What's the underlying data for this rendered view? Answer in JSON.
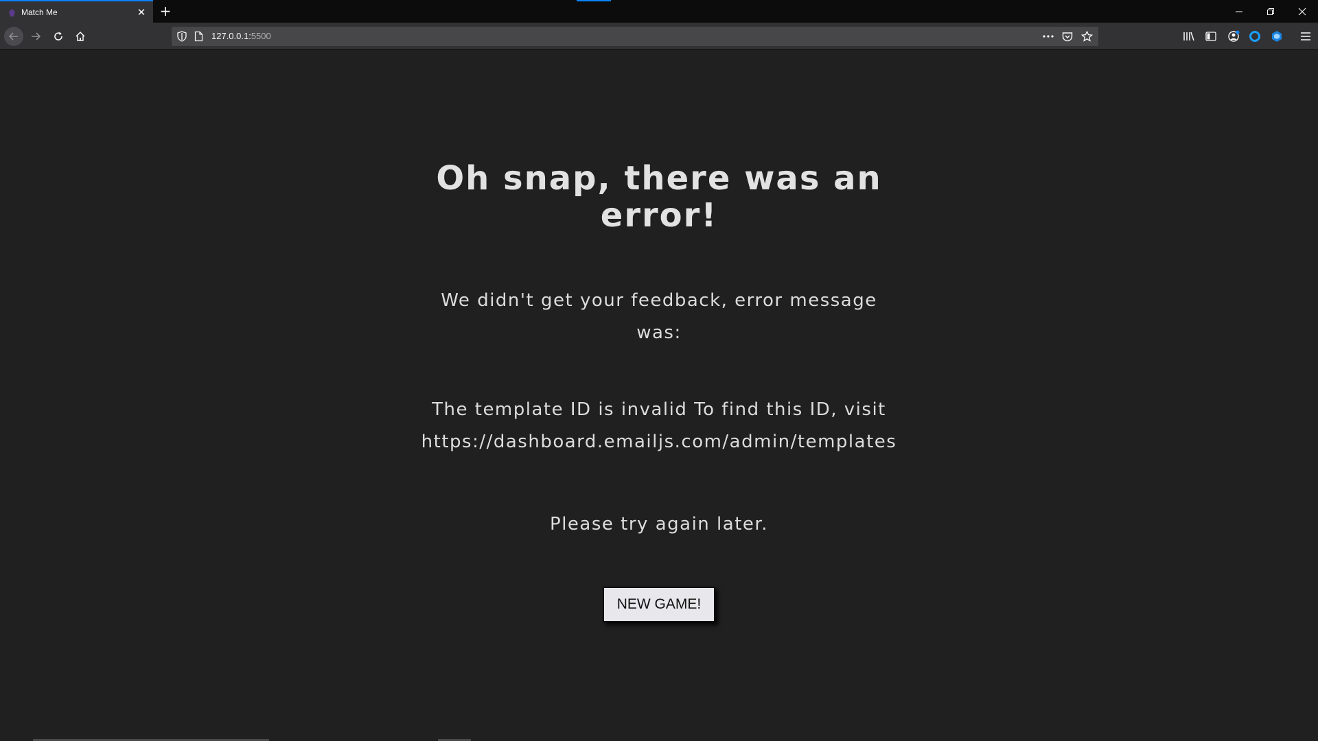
{
  "browser": {
    "tab_title": "Match Me",
    "url_host": "127.0.0.1:",
    "url_port": "5500"
  },
  "page": {
    "title": "Oh snap, there was an error!",
    "lead": "We didn't get your feedback, error message was:",
    "error_message": "The template ID is invalid To find this ID, visit https://dashboard.emailjs.com/admin/templates",
    "retry": "Please try again later.",
    "button_label": "NEW GAME!"
  },
  "colors": {
    "background": "#202020",
    "text": "#dcdcdc",
    "button_bg": "#e8e8ec",
    "accent": "#0a84ff"
  }
}
